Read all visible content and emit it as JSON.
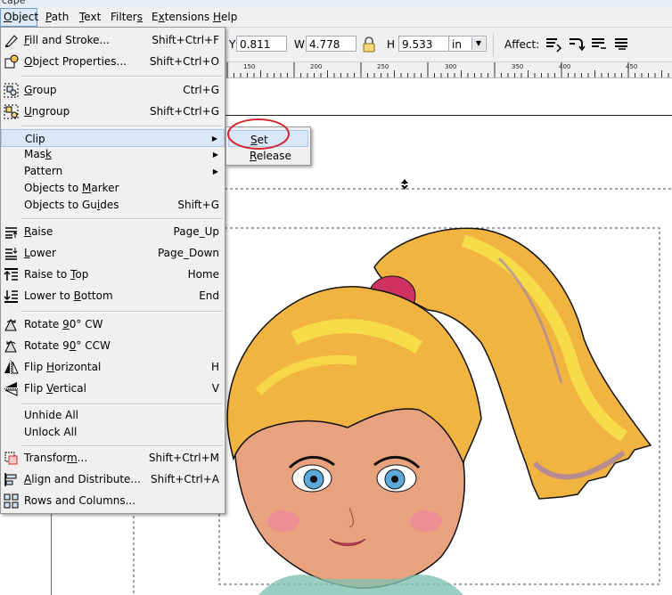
{
  "window": {
    "title_fragment": "cape"
  },
  "menubar": {
    "items": [
      {
        "label": "Object",
        "key": "O",
        "rest": "bject"
      },
      {
        "label": "Path",
        "key": "P",
        "rest": "ath"
      },
      {
        "label": "Text",
        "key": "T",
        "rest": "ext"
      },
      {
        "label": "Filters",
        "key": "s",
        "pre": "Filter"
      },
      {
        "label": "Extensions",
        "key": "x",
        "pre": "E",
        "rest": "tensions"
      },
      {
        "label": "Help",
        "key": "H",
        "rest": "elp"
      }
    ]
  },
  "toolbar": {
    "y_value": "0.811",
    "w_label": "W",
    "w_value": "4.778",
    "h_label": "H",
    "h_value": "9.533",
    "unit": "in",
    "affect_label": "Affect:"
  },
  "ruler": {
    "labels": [
      "150",
      "200",
      "250",
      "300",
      "350",
      "400",
      "450"
    ]
  },
  "object_menu": {
    "items": [
      {
        "label": "Fill and Stroke...",
        "shortcut": "Shift+Ctrl+F",
        "icon": "fill-stroke-icon"
      },
      {
        "label": "Object Properties...",
        "shortcut": "Shift+Ctrl+O",
        "icon": "object-properties-icon"
      },
      {
        "label": "Group",
        "shortcut": "Ctrl+G",
        "icon": "group-icon"
      },
      {
        "label": "Ungroup",
        "shortcut": "Shift+Ctrl+G",
        "icon": "ungroup-icon"
      },
      {
        "label": "Clip",
        "shortcut": "",
        "submenu": true
      },
      {
        "label": "Mask",
        "shortcut": "",
        "submenu": true
      },
      {
        "label": "Pattern",
        "shortcut": "",
        "submenu": true
      },
      {
        "label": "Objects to Marker",
        "shortcut": ""
      },
      {
        "label": "Objects to Guides",
        "shortcut": "Shift+G"
      },
      {
        "label": "Raise",
        "shortcut": "Page_Up",
        "icon": "raise-icon"
      },
      {
        "label": "Lower",
        "shortcut": "Page_Down",
        "icon": "lower-icon"
      },
      {
        "label": "Raise to Top",
        "shortcut": "Home",
        "icon": "raise-to-top-icon"
      },
      {
        "label": "Lower to Bottom",
        "shortcut": "End",
        "icon": "lower-to-bottom-icon"
      },
      {
        "label": "Rotate 90° CW",
        "shortcut": "",
        "icon": "rotate-cw-icon"
      },
      {
        "label": "Rotate 90° CCW",
        "shortcut": "",
        "icon": "rotate-ccw-icon"
      },
      {
        "label": "Flip Horizontal",
        "shortcut": "H",
        "icon": "flip-horizontal-icon"
      },
      {
        "label": "Flip Vertical",
        "shortcut": "V",
        "icon": "flip-vertical-icon"
      },
      {
        "label": "Unhide All",
        "shortcut": ""
      },
      {
        "label": "Unlock All",
        "shortcut": ""
      },
      {
        "label": "Transform...",
        "shortcut": "Shift+Ctrl+M",
        "icon": "transform-icon"
      },
      {
        "label": "Align and Distribute...",
        "shortcut": "Shift+Ctrl+A",
        "icon": "align-icon"
      },
      {
        "label": "Rows and Columns...",
        "shortcut": "",
        "icon": "grid-icon"
      }
    ]
  },
  "clip_submenu": {
    "items": [
      {
        "label": "Set"
      },
      {
        "label": "Release"
      }
    ]
  },
  "colors": {
    "highlight": "#d9e7f7",
    "annotation_red": "#d3202a",
    "hair_yellow": "#f5c93a",
    "skin": "#e9a27e"
  }
}
